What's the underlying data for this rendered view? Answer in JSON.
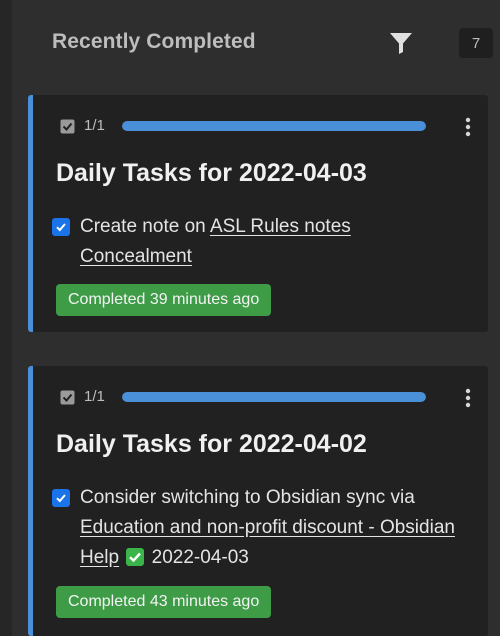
{
  "header": {
    "title": "Recently Completed",
    "filter_icon": "filter-icon",
    "count": "7"
  },
  "colors": {
    "accent": "#4a90d9",
    "badge_green": "#3e9c47",
    "card_bg": "#212121",
    "lane_bg": "#2e2e2e"
  },
  "cards": [
    {
      "subtask_count": "1/1",
      "progress": 1.0,
      "title": "Daily Tasks for 2022-04-03",
      "task": {
        "prefix": "Create note on ",
        "link": "ASL Rules notes Concealment",
        "checked": true
      },
      "completed": "Completed 39 minutes ago"
    },
    {
      "subtask_count": "1/1",
      "progress": 1.0,
      "title": "Daily Tasks for 2022-04-02",
      "task": {
        "prefix": "Consider switching to Obsidian sync via ",
        "link": "Education and non-profit discount - Obsidian Help",
        "done_emoji": "✅",
        "suffix": " 2022-04-03",
        "checked": true
      },
      "completed": "Completed 43 minutes ago"
    }
  ]
}
